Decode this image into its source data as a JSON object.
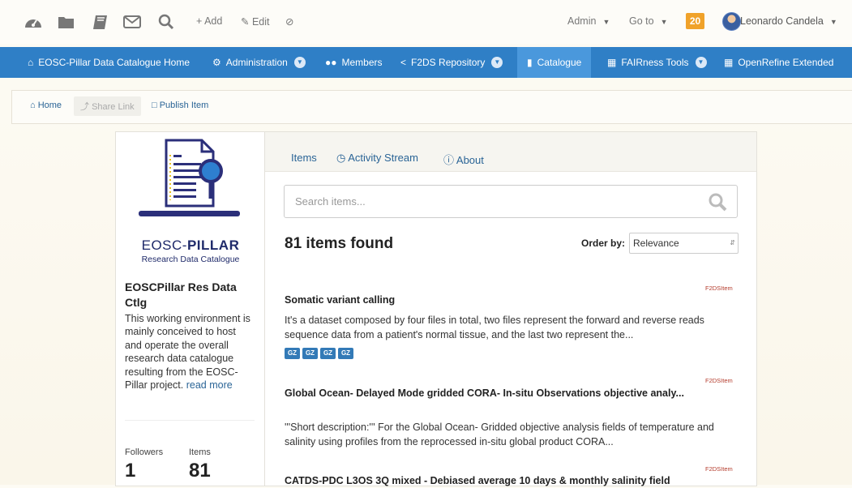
{
  "toolbar": {
    "icons": [
      "dashboard-icon",
      "folder-icon",
      "book-icon",
      "mail-icon",
      "search-icon"
    ],
    "add_label": "+ Add",
    "edit_label": "Edit",
    "admin_label": "Admin",
    "goto_label": "Go to",
    "notification_count": "20",
    "user_name": "Leonardo Candela"
  },
  "nav": {
    "items": [
      {
        "label": "EOSC-Pillar Data Catalogue Home",
        "icon": "home-icon"
      },
      {
        "label": "Administration",
        "icon": "gear-icon"
      },
      {
        "label": "Members",
        "icon": "users-icon"
      },
      {
        "label": "F2DS Repository",
        "icon": "share-icon"
      },
      {
        "label": "Catalogue",
        "icon": "book-icon"
      },
      {
        "label": "FAIRness Tools",
        "icon": "document-icon"
      },
      {
        "label": "OpenRefine Extended",
        "icon": "table-icon"
      }
    ],
    "active_index": 4,
    "accent_color": "#2f7fc6"
  },
  "breadcrumb": {
    "home": "Home",
    "share_link": "Share Link",
    "publish_item": "Publish Item"
  },
  "catalogue": {
    "logo_line1": "EOSC-",
    "logo_line1_bold": "PILLAR",
    "logo_line2": "Research Data Catalogue",
    "title": "EOSCPillar Res Data Ctlg",
    "description": "This working environment is mainly conceived to host and operate the overall research data catalogue resulting from the EOSC-Pillar project.",
    "read_more": "read more",
    "followers_label": "Followers",
    "followers_value": "1",
    "items_label": "Items",
    "items_value": "81"
  },
  "tabs": [
    {
      "label": "Items"
    },
    {
      "label": "Activity Stream"
    },
    {
      "label": "About"
    }
  ],
  "search": {
    "placeholder": "Search items..."
  },
  "results": {
    "found_text": "81 items found",
    "order_label": "Order by:",
    "order_value": "Relevance"
  },
  "items": [
    {
      "type_tag": "F2DSItem",
      "title": "Somatic variant calling",
      "description": "It's a dataset composed by four files in total, two files represent the forward and reverse reads sequence data from a patient's normal tissue, and the last two represent the...",
      "formats": [
        "GZ",
        "GZ",
        "GZ",
        "GZ"
      ]
    },
    {
      "type_tag": "F2DSItem",
      "title": "Global Ocean- Delayed Mode gridded CORA- In-situ Observations objective analy...",
      "description": "'''Short description:''' For the Global Ocean- Gridded objective analysis fields of temperature and salinity using profiles from the reprocessed in-situ global product CORA..."
    },
    {
      "type_tag": "F2DSItem",
      "title": "CATDS-PDC L3OS 3Q mixed - Debiased average 10 days & monthly salinity field"
    }
  ]
}
